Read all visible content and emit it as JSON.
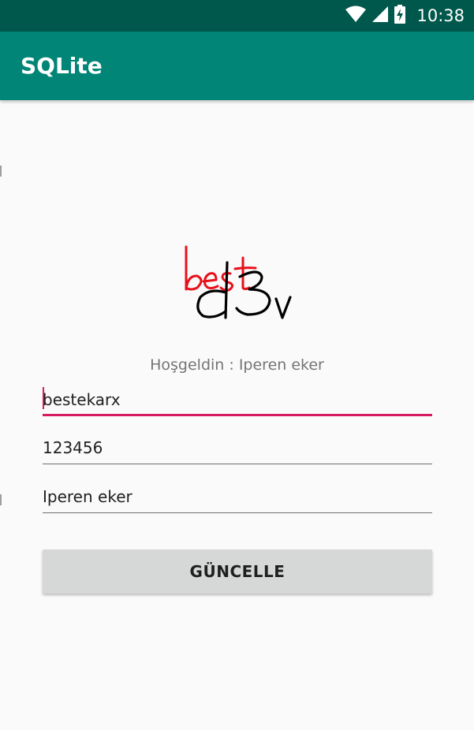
{
  "status_bar": {
    "time": "10:38",
    "icons": [
      "wifi-icon",
      "cellular-signal-icon",
      "battery-charging-icon"
    ]
  },
  "app_bar": {
    "title": "SQLite"
  },
  "logo": {
    "top_text": "best",
    "bottom_text": "d3v",
    "top_color": "#e8101a",
    "bottom_color": "#000000"
  },
  "welcome": {
    "text": "Hoşgeldin : Iperen eker"
  },
  "form": {
    "username_value": "bestekarx",
    "password_value": "123456",
    "name_value": "Iperen eker",
    "update_button_label": "GÜNCELLE"
  },
  "colors": {
    "status_bar": "#00574b",
    "primary": "#008577",
    "accent": "#d81b60",
    "background": "#fafafa"
  }
}
